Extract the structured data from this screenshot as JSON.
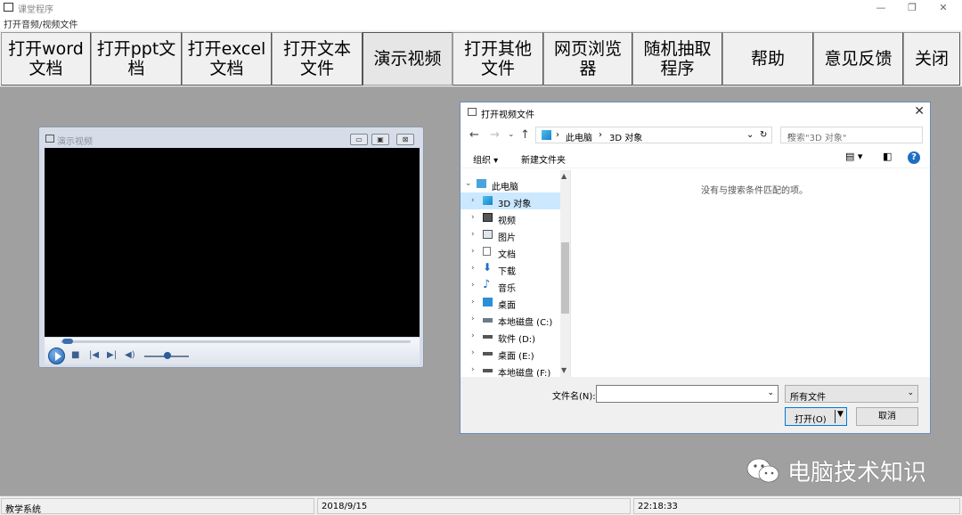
{
  "window": {
    "title": "课堂程序",
    "menu_item": "打开音频/视频文件",
    "min": "—",
    "max": "❐",
    "close": "✕"
  },
  "toolbar": {
    "buttons": [
      "打开word文档",
      "打开ppt文档",
      "打开excel文档",
      "打开文本文件",
      "演示视频",
      "打开其他文件",
      "网页浏览器",
      "随机抽取程序",
      "帮助",
      "意见反馈",
      "关闭"
    ]
  },
  "video_window": {
    "title": "演示视频",
    "btn_min": "▭",
    "btn_max": "▣",
    "btn_close": "⊠"
  },
  "dialog": {
    "title": "打开视频文件",
    "close": "✕",
    "path": [
      "此电脑",
      "3D 对象"
    ],
    "search_placeholder": "搜索\"3D 对象\"",
    "organize": "组织 ▾",
    "new_folder": "新建文件夹",
    "help": "?",
    "empty_message": "没有与搜索条件匹配的项。",
    "tree": [
      {
        "label": "此电脑",
        "icon": "computer-icon"
      },
      {
        "label": "3D 对象",
        "icon": "cube-icon"
      },
      {
        "label": "视频",
        "icon": "video-icon"
      },
      {
        "label": "图片",
        "icon": "picture-icon"
      },
      {
        "label": "文档",
        "icon": "document-icon"
      },
      {
        "label": "下载",
        "icon": "download-icon"
      },
      {
        "label": "音乐",
        "icon": "music-icon"
      },
      {
        "label": "桌面",
        "icon": "desktop-icon"
      },
      {
        "label": "本地磁盘 (C:)",
        "icon": "drive-icon"
      },
      {
        "label": "软件 (D:)",
        "icon": "drive-icon"
      },
      {
        "label": "桌面 (E:)",
        "icon": "drive-icon"
      },
      {
        "label": "本地磁盘 (F:)",
        "icon": "drive-icon"
      }
    ],
    "filename_label": "文件名(N):",
    "filename_value": "",
    "filetype": "所有文件",
    "open_label": "打开(O)",
    "cancel_label": "取消"
  },
  "watermark": "电脑技术知识",
  "status": {
    "system": "教学系统",
    "date": "2018/9/15",
    "time": "22:18:33"
  }
}
